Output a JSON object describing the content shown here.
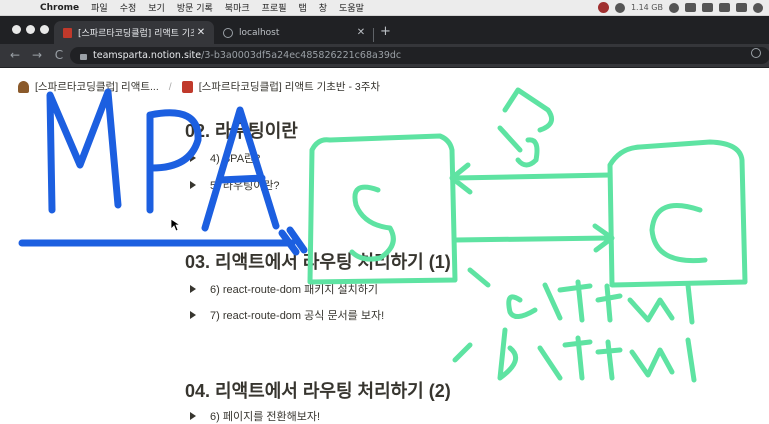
{
  "menubar": {
    "app_name": "Chrome",
    "items": [
      "파일",
      "수정",
      "보기",
      "방문 기록",
      "북마크",
      "프로필",
      "탭",
      "창",
      "도움말"
    ],
    "memory": "1.14 GB"
  },
  "tabs": [
    {
      "title": "[스파르타코딩클럽] 리액트 기초반 -",
      "close": "✕"
    },
    {
      "title": "localhost",
      "close": "✕"
    }
  ],
  "new_tab": "+",
  "nav": {
    "back": "←",
    "forward": "→",
    "reload": "C"
  },
  "address": {
    "host": "teamsparta.notion.site",
    "path": "/3-b3a0003df5a24ec485826221c68a39dc"
  },
  "breadcrumbs": [
    {
      "label": "[스파르타코딩클럽] 리액트...",
      "icon": "person-emoji-icon"
    },
    {
      "label": "[스파르타코딩클럽] 리액트 기초반 - 3주차",
      "icon": "book-icon"
    }
  ],
  "breadcrumb_separator": "/",
  "sections": [
    {
      "heading": "02. 라우팅이란",
      "toggles": [
        "4) SPA란?",
        "5) 라우팅이란?"
      ]
    },
    {
      "heading": "03. 리액트에서 라우팅 처리하기 (1)",
      "toggles": [
        "6) react-route-dom 패키지 설치하기",
        "7) react-route-dom 공식 문서를 보자!"
      ]
    },
    {
      "heading": "04. 리액트에서 라우팅 처리하기 (2)",
      "toggles": [
        "6) 페이지를 전환해보자!"
      ]
    }
  ],
  "annotations": {
    "blue_text": "MPA",
    "green_server": "S",
    "green_client": "C",
    "green_a": "a",
    "green_b": "b",
    "green_a_html": "a.html",
    "green_b_html": "b.html",
    "blue_color": "#1c5fe0",
    "green_color": "#5ee3a2"
  }
}
